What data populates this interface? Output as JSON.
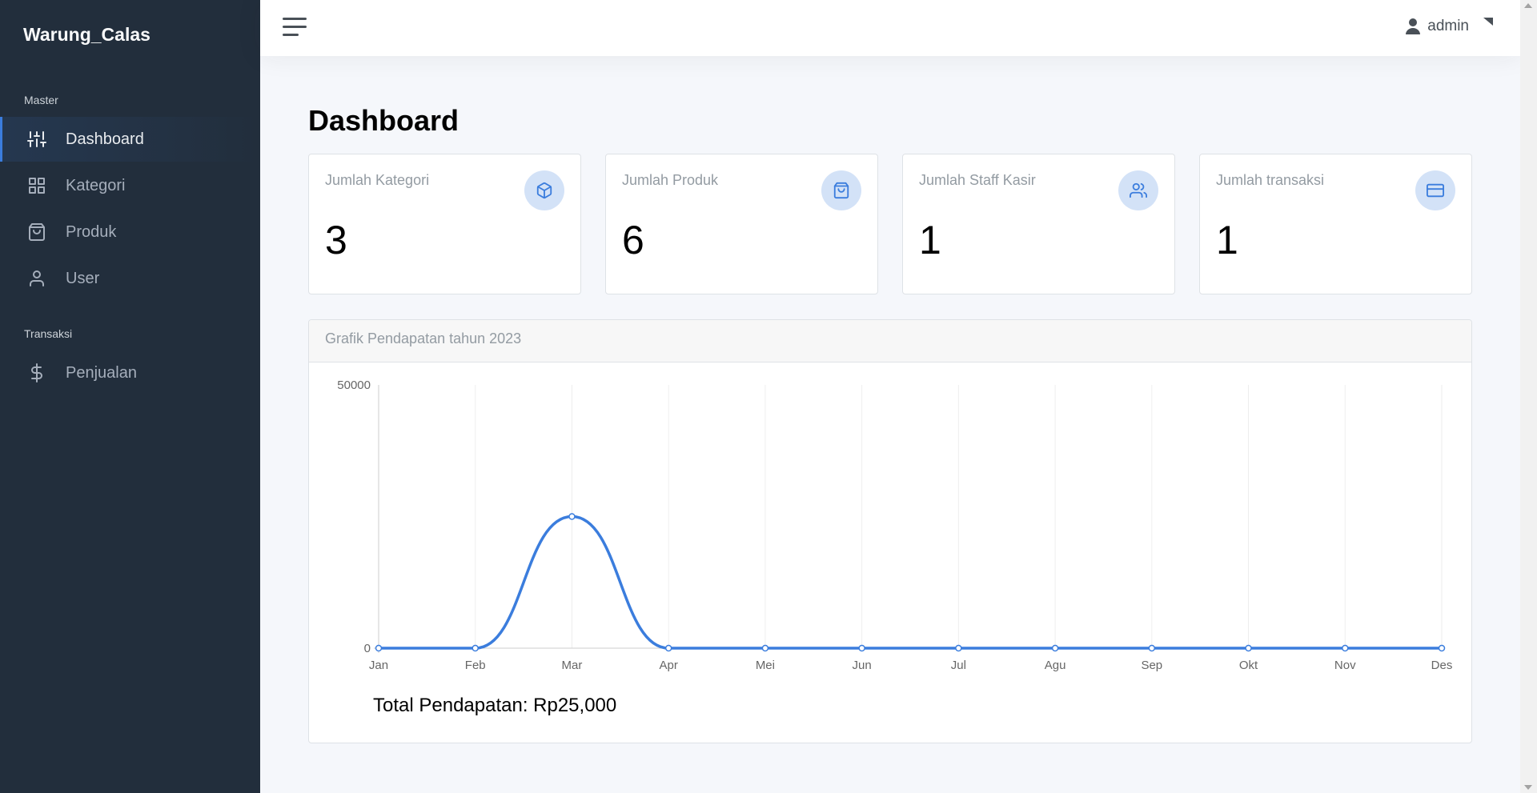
{
  "brand": "Warung_Calas",
  "sidebar": {
    "sections": [
      {
        "header": "Master"
      },
      {
        "header": "Transaksi"
      }
    ],
    "items": [
      {
        "label": "Dashboard",
        "icon": "sliders-icon"
      },
      {
        "label": "Kategori",
        "icon": "grid-icon"
      },
      {
        "label": "Produk",
        "icon": "shopping-bag-icon"
      },
      {
        "label": "User",
        "icon": "user-icon"
      },
      {
        "label": "Penjualan",
        "icon": "dollar-sign-icon"
      }
    ]
  },
  "topbar": {
    "user": "admin"
  },
  "page": {
    "title": "Dashboard"
  },
  "stats": [
    {
      "title": "Jumlah Kategori",
      "value": "3",
      "icon": "package-icon"
    },
    {
      "title": "Jumlah Produk",
      "value": "6",
      "icon": "shopping-bag-icon"
    },
    {
      "title": "Jumlah Staff Kasir",
      "value": "1",
      "icon": "users-icon"
    },
    {
      "title": "Jumlah transaksi",
      "value": "1",
      "icon": "credit-card-icon"
    }
  ],
  "chart": {
    "header": "Grafik Pendapatan tahun 2023",
    "total": "Total Pendapatan: Rp25,000"
  },
  "chart_data": {
    "type": "line",
    "categories": [
      "Jan",
      "Feb",
      "Mar",
      "Apr",
      "Mei",
      "Jun",
      "Jul",
      "Agu",
      "Sep",
      "Okt",
      "Nov",
      "Des"
    ],
    "series": [
      {
        "values": [
          0,
          0,
          25000,
          0,
          0,
          0,
          0,
          0,
          0,
          0,
          0,
          0
        ]
      }
    ],
    "ylim": [
      0,
      50000
    ],
    "yticks": [
      0,
      50000
    ],
    "grid": "vertical",
    "line_color": "#3b7ddd",
    "title": "",
    "xlabel": "",
    "ylabel": ""
  },
  "colors": {
    "sidebar_bg": "#222e3c",
    "accent": "#3b7ddd",
    "icon_circle": "#d3e2f7"
  }
}
